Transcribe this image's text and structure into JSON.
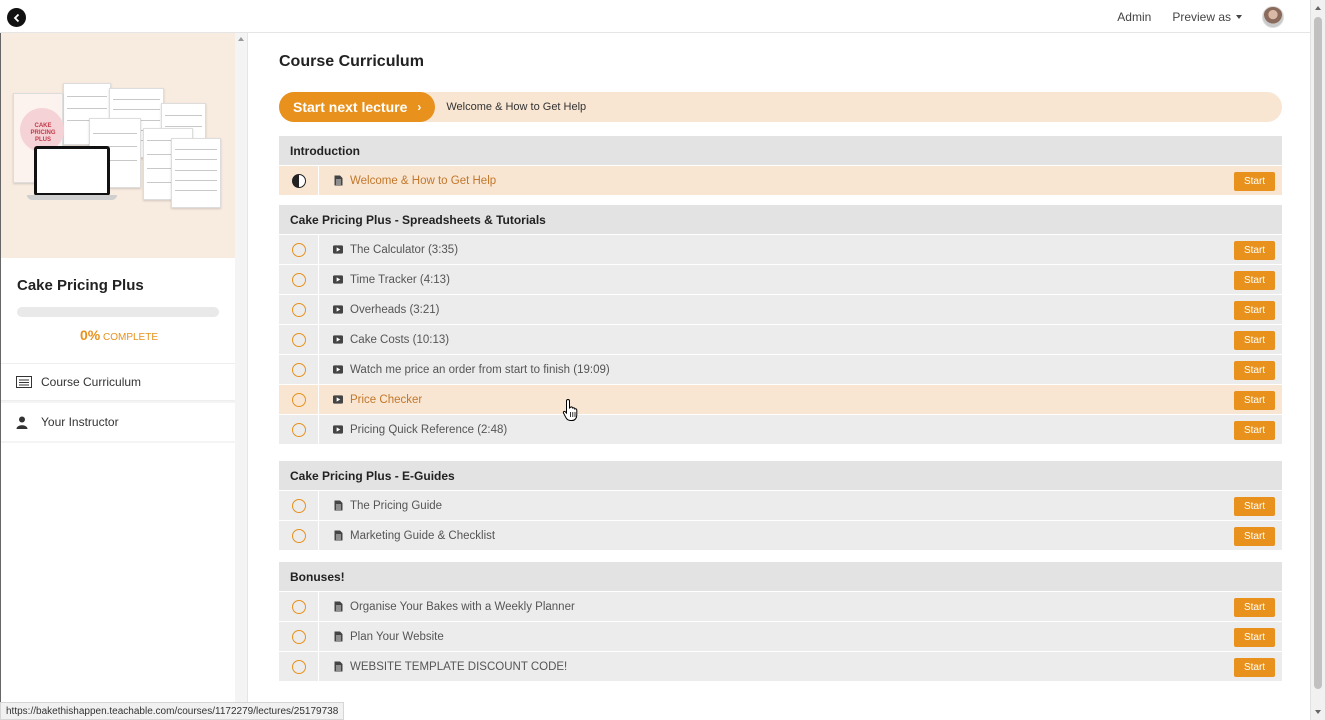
{
  "topbar": {
    "admin_label": "Admin",
    "preview_label": "Preview as"
  },
  "sidebar": {
    "course_title": "Cake Pricing Plus",
    "progress_value": 0,
    "progress_pct": "0%",
    "progress_label": "COMPLETE",
    "nav": [
      {
        "label": "Course Curriculum",
        "icon": "curriculum-icon",
        "active": true
      },
      {
        "label": "Your Instructor",
        "icon": "user-icon",
        "active": false
      }
    ],
    "hero_text": "CAKE PRICING PLUS"
  },
  "main": {
    "page_title": "Course Curriculum",
    "next_button_label": "Start next lecture",
    "next_lecture_title": "Welcome & How to Get Help",
    "start_label": "Start",
    "sections": [
      {
        "title": "Introduction",
        "lectures": [
          {
            "title": "Welcome & How to Get Help",
            "type": "document",
            "status": "in-progress",
            "highlight": true
          }
        ]
      },
      {
        "title": "Cake Pricing Plus - Spreadsheets & Tutorials",
        "lectures": [
          {
            "title": "The Calculator (3:35)",
            "type": "video",
            "status": "not-started"
          },
          {
            "title": "Time Tracker (4:13)",
            "type": "video",
            "status": "not-started"
          },
          {
            "title": "Overheads (3:21)",
            "type": "video",
            "status": "not-started"
          },
          {
            "title": "Cake Costs (10:13)",
            "type": "video",
            "status": "not-started"
          },
          {
            "title": "Watch me price an order from start to finish (19:09)",
            "type": "video",
            "status": "not-started"
          },
          {
            "title": "Price Checker",
            "type": "video",
            "status": "not-started",
            "highlight": true
          },
          {
            "title": "Pricing Quick Reference (2:48)",
            "type": "video",
            "status": "not-started"
          }
        ]
      },
      {
        "title": "Cake Pricing Plus - E-Guides",
        "lectures": [
          {
            "title": "The Pricing Guide",
            "type": "document",
            "status": "not-started"
          },
          {
            "title": "Marketing Guide & Checklist",
            "type": "document",
            "status": "not-started"
          }
        ]
      },
      {
        "title": "Bonuses!",
        "lectures": [
          {
            "title": "Organise Your Bakes with a Weekly Planner",
            "type": "document",
            "status": "not-started"
          },
          {
            "title": "Plan Your Website",
            "type": "document",
            "status": "not-started"
          },
          {
            "title": "WEBSITE TEMPLATE DISCOUNT CODE!",
            "type": "document",
            "status": "not-started"
          }
        ]
      }
    ]
  },
  "status_bar_url": "https://bakethishappen.teachable.com/courses/1172279/lectures/25179738",
  "colors": {
    "accent": "#e8911c",
    "highlight_row": "#f8e6d3",
    "section_bg": "#e3e3e3",
    "row_bg": "#ececec"
  }
}
